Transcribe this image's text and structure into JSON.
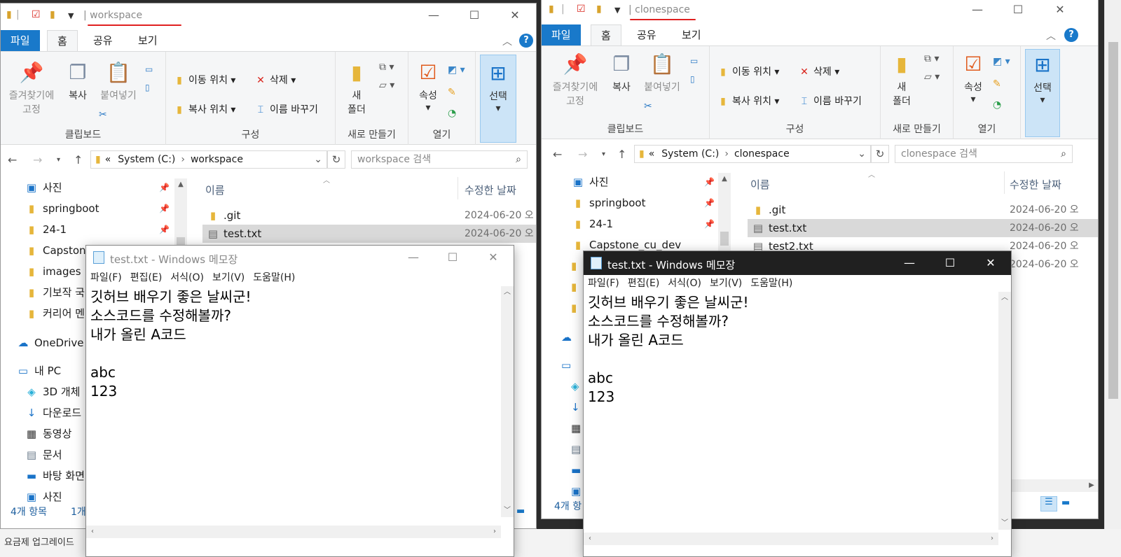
{
  "left_explorer": {
    "title": "workspace",
    "tabs": {
      "file": "파일",
      "home": "홈",
      "share": "공유",
      "view": "보기"
    },
    "ribbon": {
      "clipboard": {
        "pin": "즐겨찾기에\n고정",
        "copy": "복사",
        "paste": "붙여넣기",
        "label": "클립보드"
      },
      "organize": {
        "move_to": "이동 위치",
        "copy_to": "복사 위치",
        "delete": "삭제",
        "rename": "이름 바꾸기",
        "label": "구성"
      },
      "new": {
        "new_folder": "새\n폴더",
        "label": "새로 만들기"
      },
      "open": {
        "properties": "속성",
        "label": "열기"
      },
      "select": {
        "select": "선택"
      }
    },
    "address": {
      "prefix": "«",
      "drive": "System (C:)",
      "folder": "workspace"
    },
    "search_placeholder": "workspace 검색",
    "nav": [
      "사진",
      "springboot",
      "24-1",
      "Capstone",
      "images",
      "기보작 국",
      "커리어 멘",
      "OneDrive -",
      "내 PC",
      "3D 개체",
      "다운로드",
      "동영상",
      "문서",
      "바탕 화면",
      "사진"
    ],
    "columns": {
      "name": "이름",
      "modified": "수정한 날짜"
    },
    "files": [
      {
        "name": ".git",
        "date": "2024-06-20 오"
      },
      {
        "name": "test.txt",
        "date": "2024-06-20 오"
      }
    ],
    "status": {
      "count": "4개 항목",
      "selected": "1개"
    }
  },
  "right_explorer": {
    "title": "clonespace",
    "tabs": {
      "file": "파일",
      "home": "홈",
      "share": "공유",
      "view": "보기"
    },
    "ribbon": {
      "clipboard": {
        "pin": "즐겨찾기에\n고정",
        "copy": "복사",
        "paste": "붙여넣기",
        "label": "클립보드"
      },
      "organize": {
        "move_to": "이동 위치",
        "copy_to": "복사 위치",
        "delete": "삭제",
        "rename": "이름 바꾸기",
        "label": "구성"
      },
      "new": {
        "new_folder": "새\n폴더",
        "label": "새로 만들기"
      },
      "open": {
        "properties": "속성",
        "label": "열기"
      },
      "select": {
        "select": "선택"
      }
    },
    "address": {
      "prefix": "«",
      "drive": "System (C:)",
      "folder": "clonespace"
    },
    "search_placeholder": "clonespace 검색",
    "nav": [
      "사진",
      "springboot",
      "24-1",
      "Capstone_cu_dev"
    ],
    "columns": {
      "name": "이름",
      "modified": "수정한 날짜"
    },
    "files": [
      {
        "name": ".git",
        "date": "2024-06-20 오"
      },
      {
        "name": "test.txt",
        "date": "2024-06-20 오"
      },
      {
        "name": "test2.txt",
        "date": "2024-06-20 오"
      },
      {
        "name": "",
        "date": "2024-06-20 오"
      }
    ],
    "status": {
      "count": "4개 항"
    }
  },
  "left_notepad": {
    "title": "test.txt - Windows 메모장",
    "menu": [
      "파일(F)",
      "편집(E)",
      "서식(O)",
      "보기(V)",
      "도움말(H)"
    ],
    "content": "깃허브 배우기 좋은 날씨군!\n소스코드를 수정해볼까?\n내가 올린 A코드\n\nabc\n123"
  },
  "right_notepad": {
    "title": "test.txt - Windows 메모장",
    "menu": [
      "파일(F)",
      "편집(E)",
      "서식(O)",
      "보기(V)",
      "도움말(H)"
    ],
    "content": "깃허브 배우기 좋은 날씨군!\n소스코드를 수정해볼까?\n내가 올린 A코드\n\nabc\n123"
  },
  "background": {
    "bottom_text": "요금제 업그레이드"
  },
  "colors": {
    "accent": "#1979ca",
    "annotation": "#e02020",
    "selection": "#d9d9d9"
  }
}
